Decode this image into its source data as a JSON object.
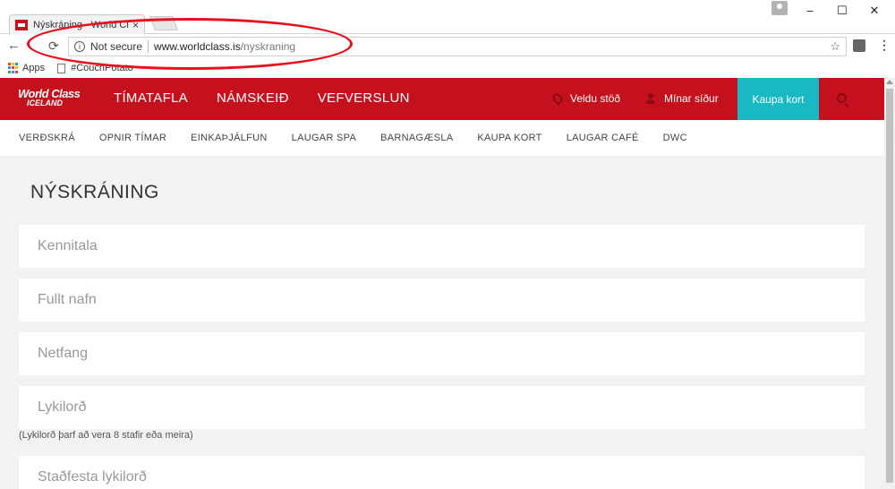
{
  "browser": {
    "tab_title": "Nýskráning - World Class",
    "tab_close": "×",
    "security_label": "Not secure",
    "url_host": "www.worldclass.is",
    "url_path": "/nyskraning",
    "window_minimize": "–",
    "window_maximize": "☐",
    "window_close": "✕",
    "back_glyph": "←",
    "reload_glyph": "⟳",
    "info_glyph": "i",
    "star_glyph": "☆",
    "menu_glyph": "⋮"
  },
  "bookmarks": [
    {
      "label": "Apps",
      "icon": "apps-grid-icon"
    },
    {
      "label": "#CouchPotato",
      "icon": "page-icon"
    }
  ],
  "site": {
    "logo_main": "World Class",
    "logo_sub": "ICELAND",
    "main_nav": [
      "TÍMATAFLA",
      "NÁMSKEIÐ",
      "VEFVERSLUN"
    ],
    "select_station": "Veldu stöð",
    "my_pages": "Mínar síður",
    "buy_card": "Kaupa kort",
    "sub_nav": [
      "VERÐSKRÁ",
      "OPNIR TÍMAR",
      "EINKAÞJÁLFUN",
      "LAUGAR SPA",
      "BARNAGÆSLA",
      "KAUPA KORT",
      "LAUGAR CAFÉ",
      "DWC"
    ],
    "accent_color": "#c4111d",
    "button_color": "#19b9c3"
  },
  "form": {
    "title": "NÝSKRÁNING",
    "fields": [
      {
        "placeholder": "Kennitala"
      },
      {
        "placeholder": "Fullt nafn"
      },
      {
        "placeholder": "Netfang"
      },
      {
        "placeholder": "Lykilorð"
      },
      {
        "placeholder": "Staðfesta lykilorð"
      }
    ],
    "password_hint": "(Lykilorð þarf að vera 8 stafir eða meira)"
  },
  "annotation_color": "#e8101d"
}
